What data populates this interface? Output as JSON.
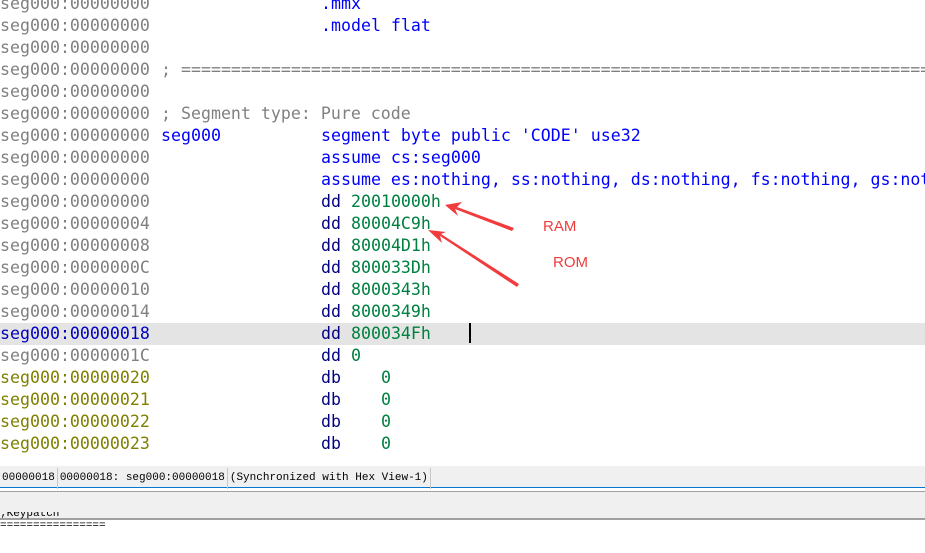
{
  "listing": [
    {
      "addr": "seg000:00000000",
      "kind": "normal",
      "col16": "",
      "col32": ".mmx",
      "type": "dir"
    },
    {
      "addr": "seg000:00000000",
      "kind": "normal",
      "col16": "",
      "col32": ".model flat",
      "type": "dir"
    },
    {
      "addr": "seg000:00000000",
      "kind": "normal",
      "col16": "",
      "col32": "",
      "type": "dir"
    },
    {
      "addr": "seg000:00000000",
      "kind": "normal",
      "comment": "; ===============================================================================",
      "type": "cmt"
    },
    {
      "addr": "seg000:00000000",
      "kind": "normal",
      "col16": "",
      "col32": "",
      "type": "dir"
    },
    {
      "addr": "seg000:00000000",
      "kind": "normal",
      "comment": "; Segment type: Pure code",
      "type": "cmt"
    },
    {
      "addr": "seg000:00000000",
      "kind": "normal",
      "col16": "seg000",
      "col32": "segment byte public 'CODE' use32",
      "type": "dir"
    },
    {
      "addr": "seg000:00000000",
      "kind": "normal",
      "col16": "",
      "col32": "assume cs:seg000",
      "type": "dir"
    },
    {
      "addr": "seg000:00000000",
      "kind": "normal",
      "col16": "",
      "col32": "assume es:nothing, ss:nothing, ds:nothing, fs:nothing, gs:nothing",
      "type": "dir"
    },
    {
      "addr": "seg000:00000000",
      "kind": "normal",
      "mn": "dd",
      "op": "20010000h",
      "type": "ins"
    },
    {
      "addr": "seg000:00000004",
      "kind": "normal",
      "mn": "dd",
      "op": "80004C9h",
      "type": "ins"
    },
    {
      "addr": "seg000:00000008",
      "kind": "normal",
      "mn": "dd",
      "op": "80004D1h",
      "type": "ins"
    },
    {
      "addr": "seg000:0000000C",
      "kind": "normal",
      "mn": "dd",
      "op": "800033Dh",
      "type": "ins"
    },
    {
      "addr": "seg000:00000010",
      "kind": "normal",
      "mn": "dd",
      "op": "8000343h",
      "type": "ins"
    },
    {
      "addr": "seg000:00000014",
      "kind": "normal",
      "mn": "dd",
      "op": "8000349h",
      "type": "ins"
    },
    {
      "addr": "seg000:00000018",
      "kind": "cur",
      "mn": "dd",
      "op": "800034Fh",
      "type": "ins"
    },
    {
      "addr": "seg000:0000001C",
      "kind": "normal",
      "mn": "dd",
      "op": "0",
      "type": "ins"
    },
    {
      "addr": "seg000:00000020",
      "kind": "data",
      "mn": "db",
      "op": "   0",
      "type": "ins"
    },
    {
      "addr": "seg000:00000021",
      "kind": "data",
      "mn": "db",
      "op": "   0",
      "type": "ins"
    },
    {
      "addr": "seg000:00000022",
      "kind": "data",
      "mn": "db",
      "op": "   0",
      "type": "ins"
    },
    {
      "addr": "seg000:00000023",
      "kind": "data",
      "mn": "db",
      "op": "   0",
      "type": "ins"
    }
  ],
  "annotations": {
    "ram": "RAM",
    "rom": "ROM",
    "color": "#f03c3c"
  },
  "status": {
    "offset": "00000018",
    "location": "00000018: seg000:00000018",
    "sync": "(Synchronized with Hex View-1)"
  },
  "output": {
    "line1": ";Keypatch",
    "line2": "================"
  }
}
